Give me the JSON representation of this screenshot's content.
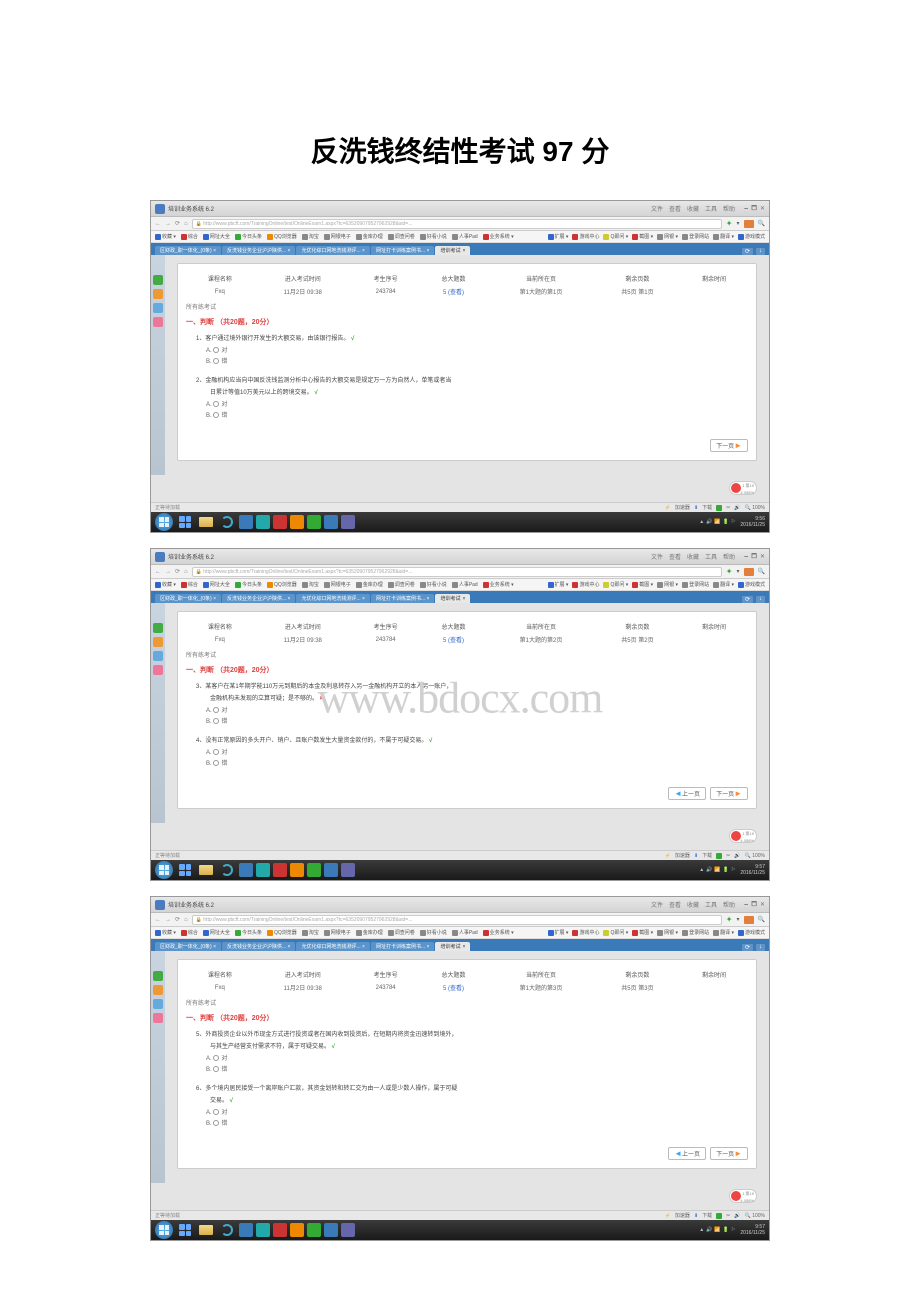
{
  "doc_title": "反洗钱终结性考试 97 分",
  "watermark": "www.bdocx.com",
  "browser": {
    "page_tab_title": "培训业务系统 6.2",
    "title_right_items": [
      "文件",
      "查看",
      "收藏",
      "工具",
      "帮助"
    ],
    "url_prefix": "http://www.pbcft.com/",
    "url_tail": "TrainingOnline/test/OnlineExam1.aspx?tc=635209079527962928&sid=...",
    "bookmarks_left": [
      {
        "icon": "ic-blue",
        "label": "收藏 ▾"
      },
      {
        "icon": "ic-red",
        "label": "综合"
      },
      {
        "icon": "ic-blue",
        "label": "网址大全"
      },
      {
        "icon": "ic-green",
        "label": "今日头条"
      },
      {
        "icon": "ic-orange",
        "label": "QQ浏览器"
      },
      {
        "icon": "ic-grey",
        "label": "淘宝"
      },
      {
        "icon": "ic-grey",
        "label": "网银电子"
      },
      {
        "icon": "ic-grey",
        "label": "金库办理"
      },
      {
        "icon": "ic-grey",
        "label": "调查问卷"
      },
      {
        "icon": "ic-grey",
        "label": "好看小说"
      },
      {
        "icon": "ic-grey",
        "label": "人事Pad"
      },
      {
        "icon": "ic-red",
        "label": "业务系统 ▾"
      }
    ],
    "bookmarks_right": [
      {
        "icon": "ic-blue",
        "label": "扩展 ▾"
      },
      {
        "icon": "ic-red",
        "label": "游戏中心"
      },
      {
        "icon": "ic-yellow",
        "label": "Q即问 ▾"
      },
      {
        "icon": "ic-red",
        "label": "截图 ▾"
      },
      {
        "icon": "ic-grey",
        "label": "网银 ▾"
      },
      {
        "icon": "ic-grey",
        "label": "登录网站"
      },
      {
        "icon": "ic-grey",
        "label": "翻译 ▾"
      },
      {
        "icon": "ic-blue",
        "label": "游戏模式"
      }
    ],
    "tabs": [
      {
        "label": "区财政_职一体化_(0条) ×"
      },
      {
        "label": "反洗钱业务企业沪沪陕供... ×"
      },
      {
        "label": "允优化综口网地洗钱测评... ×"
      },
      {
        "label": "网址打卡训练案例书... ×"
      },
      {
        "label": "培训考试",
        "close": "×"
      }
    ],
    "tab_controls": [
      "⟳",
      "↓"
    ]
  },
  "info_table": {
    "headers": [
      "课程名称",
      "进入考试时间",
      "考生序号",
      "总大题数",
      "当前所在页",
      "剩余页数",
      "剩余时间"
    ],
    "row": [
      "Fxq",
      "11月2日 09:38",
      "243784",
      "5 (查看)",
      "第1大题的第1页",
      "共5页 第1页",
      ""
    ],
    "row_alt": [
      "Fxq",
      "11月2日 09:38",
      "243784",
      "5 (查看)",
      "第1大题的第2页",
      "共5页 第2页",
      ""
    ],
    "row_alt2": [
      "Fxq",
      "11月2日 09:38",
      "243784",
      "5 (查看)",
      "第1大题的第3页",
      "共5页 第3页",
      ""
    ],
    "link": "(查看)"
  },
  "crumb": "所有练考试",
  "section": "一、判断 （共20题，20分）",
  "nav": {
    "prev": "上一页",
    "next": "下一页"
  },
  "status": {
    "left": "正等待加载",
    "right_label": "加速器",
    "down": "下载",
    "zoom": "100%"
  },
  "clock": {
    "time": "9:56",
    "date": "2016/11/25",
    "time2": "9:57",
    "time3": "9:57"
  },
  "screens": [
    {
      "questions": [
        {
          "num": "1、",
          "text": "客户通过境外银行开发生的大额交易，由该银行报告。",
          "mark": "√",
          "opts": [
            "对",
            "错"
          ]
        },
        {
          "num": "2、",
          "text": "金融机构应当向中国反洗钱监测分析中心报告的大额交易是规定万一方为自然人，单笔或者当",
          "text2": "日累计等值10万美元以上的跨境交易。",
          "mark": "√",
          "opts": [
            "对",
            "错"
          ]
        }
      ],
      "show_prev": false
    },
    {
      "questions": [
        {
          "num": "3、",
          "text": "某客户在某1年期学能110万元到期后的本金及利息转存入另一金融机构开立的本人另一账户，",
          "text2": "金融机构未发现的立算可疑；是不够的。",
          "mark": "×",
          "opts": [
            "对",
            "错"
          ]
        },
        {
          "num": "4、",
          "text": "没有正常原因的多头开户、销户、且账户数发生大量资金款付的，不属于可疑交易。",
          "mark": "√",
          "opts": [
            "对",
            "错"
          ]
        }
      ],
      "show_prev": true,
      "watermark": true
    },
    {
      "questions": [
        {
          "num": "5、",
          "text": "外商投资企业以外币现金方式进行投资或者在国内收到投资后，在短期内将资金迅速转到境外，",
          "text2": "与其生产经营支付需求不符，属于可疑交易。",
          "mark": "√",
          "opts": [
            "对",
            "错"
          ]
        },
        {
          "num": "6、",
          "text": "多个境内居民接受一个离岸账户汇款，其资金划转和转汇交为由一人或是少数人操作，属于可疑",
          "text2": "交易。",
          "mark": "√",
          "opts": [
            "对",
            "错"
          ]
        }
      ],
      "show_prev": true
    }
  ]
}
